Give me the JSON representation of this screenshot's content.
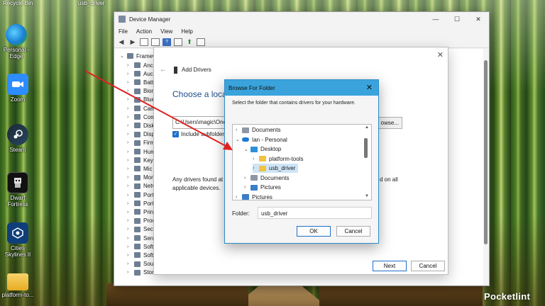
{
  "desktop": {
    "top_fragments": [
      "Recycle Bin",
      "usb_driver"
    ],
    "icons": [
      {
        "name": "edge",
        "lines": [
          "Personal -",
          "Edge"
        ]
      },
      {
        "name": "zoom",
        "lines": [
          "Zoom"
        ]
      },
      {
        "name": "steam",
        "lines": [
          "Steam"
        ]
      },
      {
        "name": "dwarf-fortress",
        "lines": [
          "Dwarf",
          "Fortress"
        ]
      },
      {
        "name": "cities-skylines",
        "lines": [
          "Cities",
          "Skylines II"
        ]
      },
      {
        "name": "platform-tools",
        "lines": [
          "platform-to..."
        ]
      }
    ],
    "watermark": "Pocketlint"
  },
  "device_manager": {
    "title": "Device Manager",
    "controls": {
      "minimize": "—",
      "maximize": "☐",
      "close": "✕"
    },
    "menu": [
      "File",
      "Action",
      "View",
      "Help"
    ],
    "tree_root": "Framew",
    "tree_items": [
      "Anc",
      "Auc",
      "Batt",
      "Biom",
      "Blue",
      "Cam",
      "Com",
      "Disk",
      "Disp",
      "Firm",
      "Hum",
      "Keyb",
      "Mic",
      "Mon",
      "Netv",
      "Port",
      "Port",
      "Prin",
      "Proc",
      "Secu",
      "Sens",
      "Soft",
      "Soft",
      "Sou",
      "Stor"
    ]
  },
  "add_drivers": {
    "close": "✕",
    "back": "←",
    "header": "Add Drivers",
    "heading": "Choose a locatio",
    "path_value": "C:\\Users\\magic\\One",
    "browse_label": "owse...",
    "include_subfolders_label": "Include subfolder",
    "info_line1": "Any drivers found at",
    "info_line2": "applicable devices.",
    "info_line3": "d on all",
    "next_label": "Next",
    "cancel_label": "Cancel"
  },
  "browse_folder": {
    "title": "Browse For Folder",
    "close": "✕",
    "description": "Select the folder that contains drivers for your hardware.",
    "tree": [
      {
        "label": "Documents",
        "icon": "doc",
        "chev": "›"
      },
      {
        "label": "Ian - Personal",
        "icon": "cloud",
        "chev": "⌄"
      },
      {
        "label": "Desktop",
        "icon": "desk",
        "chev": "⌄"
      },
      {
        "label": "platform-tools",
        "icon": "folder",
        "chev": "›"
      },
      {
        "label": "usb_driver",
        "icon": "folder",
        "chev": "›",
        "selected": true
      },
      {
        "label": "Documents",
        "icon": "doc",
        "chev": "›"
      },
      {
        "label": "Pictures",
        "icon": "pic",
        "chev": "›"
      },
      {
        "label": "Pictures",
        "icon": "pic",
        "chev": "›"
      }
    ],
    "folder_label": "Folder:",
    "folder_value": "usb_driver",
    "ok_label": "OK",
    "cancel_label": "Cancel"
  },
  "colors": {
    "accent": "#1f6fc9",
    "browse_titlebar": "#3aa3dc",
    "annotation_arrow": "#e02020",
    "selection": "#cfe5f7"
  }
}
